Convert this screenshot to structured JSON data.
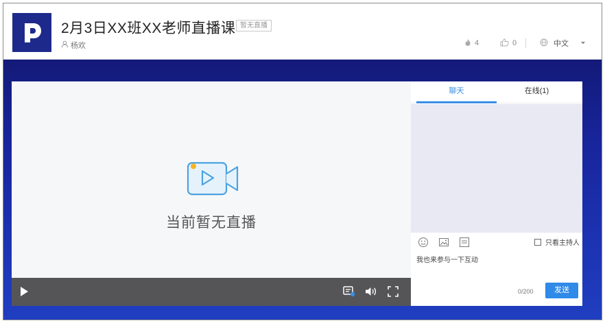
{
  "header": {
    "title": "2月3日XX班XX老师直播课",
    "status_badge": "暂无直播",
    "host_name": "杨欢",
    "view_count": "4",
    "like_count": "0",
    "language": "中文"
  },
  "player": {
    "placeholder_text": "当前暂无直播"
  },
  "chat": {
    "tabs": [
      {
        "label": "聊天"
      },
      {
        "label": "在线(1)"
      }
    ],
    "host_only_label": "只看主持人",
    "input_value": "我也来参与一下互动",
    "counter": "0/200",
    "send_label": "发送"
  },
  "colors": {
    "brand": "#1d2a8c",
    "accent": "#3a8ee6",
    "stage_top": "#131a78",
    "stage_bottom": "#1f3ec0",
    "controls_bg": "#555558",
    "messages_bg": "#e9e9f4"
  },
  "icons": {
    "logo": "p-logo-icon",
    "host": "user-icon",
    "views": "flame-icon",
    "likes": "thumbs-up-icon",
    "language": "globe-icon",
    "dropdown": "caret-down-icon",
    "placeholder": "video-camera-icon",
    "play": "play-icon",
    "subtitle": "subtitle-icon",
    "volume": "volume-icon",
    "fullscreen": "fullscreen-icon",
    "emoji": "emoji-icon",
    "image": "image-icon",
    "menu": "list-icon"
  }
}
